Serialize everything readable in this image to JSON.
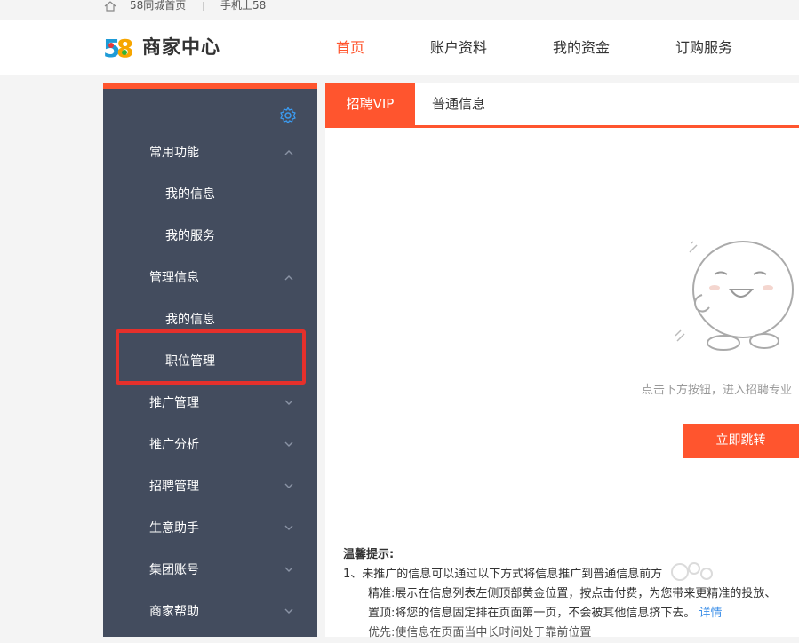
{
  "topbar": {
    "home_link": "58同城首页",
    "mobile_link": "手机上58"
  },
  "header": {
    "logo_text": "58",
    "brand": "商家中心",
    "nav": [
      {
        "label": "首页",
        "active": true
      },
      {
        "label": "账户资料",
        "active": false
      },
      {
        "label": "我的资金",
        "active": false
      },
      {
        "label": "订购服务",
        "active": false
      }
    ]
  },
  "sidebar": {
    "items": [
      {
        "label": "常用功能",
        "type": "group",
        "expanded": true
      },
      {
        "label": "我的信息",
        "type": "sub"
      },
      {
        "label": "我的服务",
        "type": "sub"
      },
      {
        "label": "管理信息",
        "type": "group",
        "expanded": true
      },
      {
        "label": "我的信息",
        "type": "sub"
      },
      {
        "label": "职位管理",
        "type": "sub",
        "highlighted": true
      },
      {
        "label": "推广管理",
        "type": "group",
        "expanded": false
      },
      {
        "label": "推广分析",
        "type": "group",
        "expanded": false
      },
      {
        "label": "招聘管理",
        "type": "group",
        "expanded": false
      },
      {
        "label": "生意助手",
        "type": "group",
        "expanded": false
      },
      {
        "label": "集团账号",
        "type": "group",
        "expanded": false
      },
      {
        "label": "商家帮助",
        "type": "group",
        "expanded": false
      }
    ]
  },
  "content": {
    "tabs": [
      {
        "label": "招聘VIP",
        "active": true
      },
      {
        "label": "普通信息",
        "active": false
      }
    ],
    "empty_text": "点击下方按钮，进入招聘专业",
    "jump_button": "立即跳转",
    "tips": {
      "title": "温馨提示:",
      "line1": "1、未推广的信息可以通过以下方式将信息推广到普通信息前方",
      "line2": "精准:展示在信息列表左侧顶部黄金位置，按点击付费，为您带来更精准的投放、",
      "line3a": "置顶:将您的信息固定排在页面第一页，不会被其他信息挤下去。",
      "line3b": "详情",
      "line4": "优先:使信息在页面当中长时间处于靠前位置"
    }
  },
  "colors": {
    "accent": "#ff552e",
    "sidebar_bg": "#434c5e",
    "highlight": "#e5302b"
  }
}
